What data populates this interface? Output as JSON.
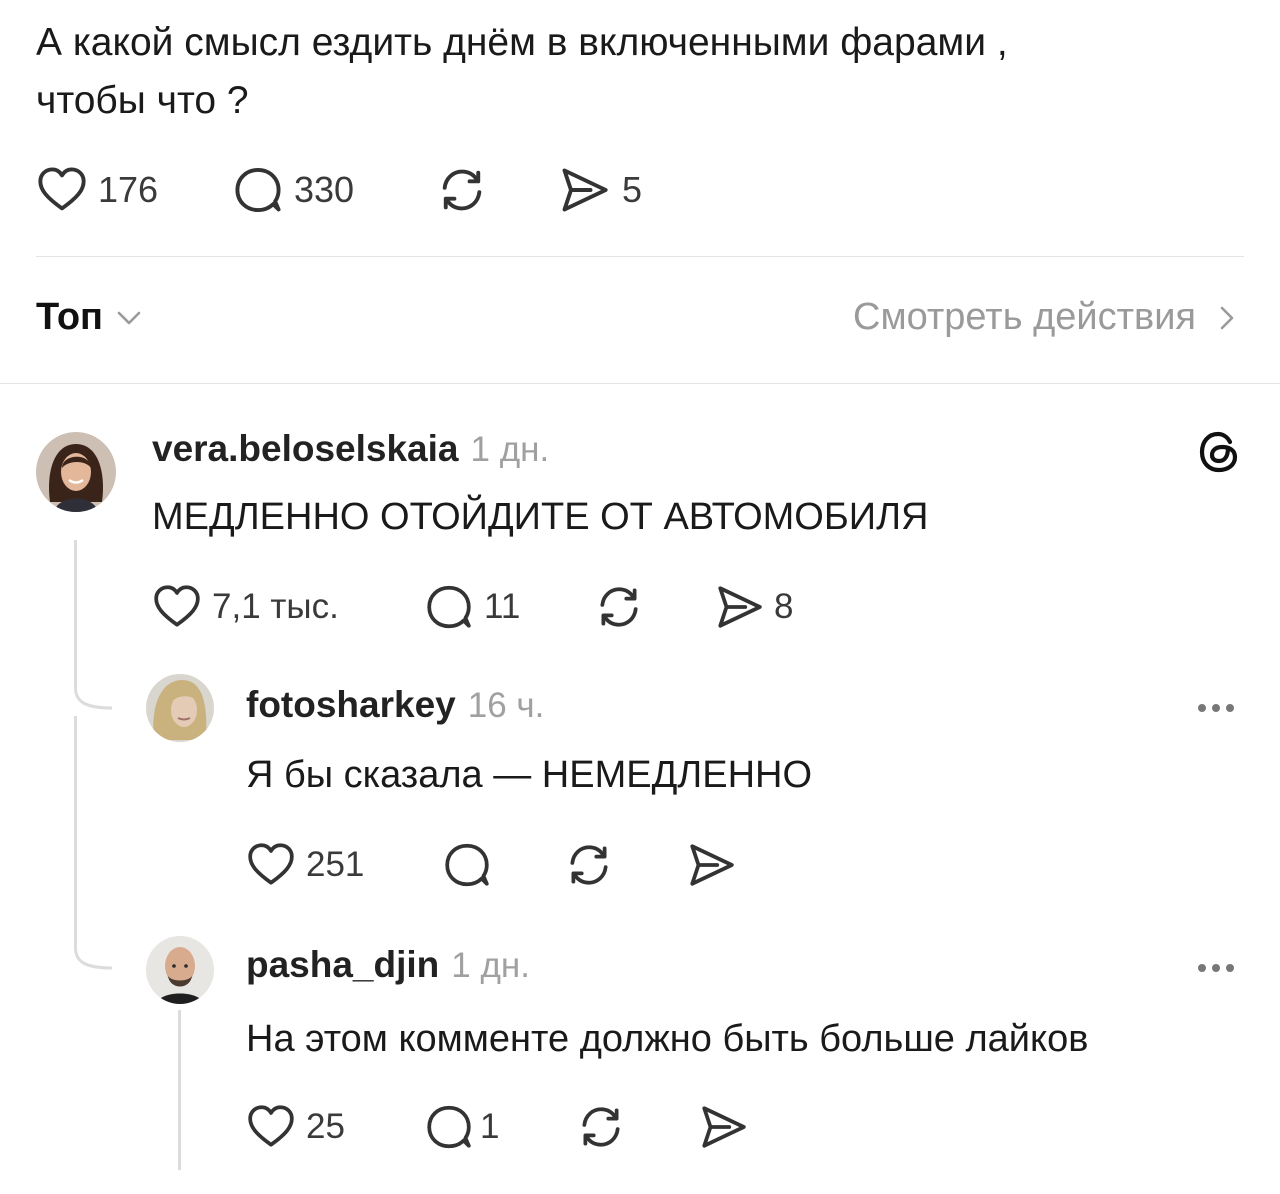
{
  "post": {
    "text_line1": "А какой смысл ездить днём в включенными фарами ,",
    "text_line2": "чтобы что ?",
    "likes": "176",
    "replies": "330",
    "shares": "5"
  },
  "sort_bar": {
    "sort_label": "Топ",
    "view_activity_label": "Смотреть действия"
  },
  "comments": [
    {
      "username": "vera.beloselskaia",
      "time": "1 дн.",
      "text": "МЕДЛЕННО ОТОЙДИТЕ ОТ АВТОМОБИЛЯ",
      "likes": "7,1 тыс.",
      "replies": "11",
      "shares": "8"
    },
    {
      "username": "fotosharkey",
      "time": "16 ч.",
      "text": "Я бы сказала — НЕМЕДЛЕННО",
      "likes": "251"
    },
    {
      "username": "pasha_djin",
      "time": "1 дн.",
      "text": "На этом комменте должно быть больше лайков",
      "likes": "25",
      "replies": "1"
    }
  ],
  "icons": {
    "like": "heart-icon",
    "reply": "comment-bubble-icon",
    "repost": "repost-icon",
    "share": "send-icon",
    "threads": "threads-logo-icon",
    "more": "more-dots-icon",
    "chevron_down": "chevron-down-icon",
    "chevron_right": "chevron-right-icon"
  }
}
